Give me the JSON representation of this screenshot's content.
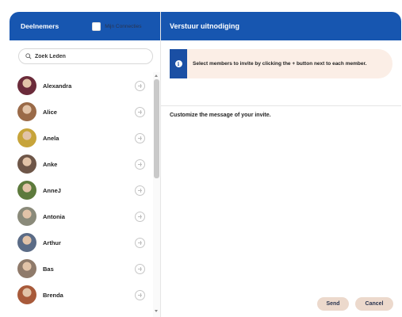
{
  "left_panel": {
    "title": "Deelnemers",
    "toggle_label": "Mijn Connecties",
    "search_placeholder": "Zoek Leden",
    "members": [
      {
        "name": "Alexandra",
        "avatar_color": "#6b2b3a"
      },
      {
        "name": "Alice",
        "avatar_color": "#9a6a48"
      },
      {
        "name": "Anela",
        "avatar_color": "#c7a43a"
      },
      {
        "name": "Anke",
        "avatar_color": "#6e5648"
      },
      {
        "name": "AnneJ",
        "avatar_color": "#5d7a3c"
      },
      {
        "name": "Antonia",
        "avatar_color": "#8a8a7a"
      },
      {
        "name": "Arthur",
        "avatar_color": "#5a6b86"
      },
      {
        "name": "Bas",
        "avatar_color": "#8f7a6a"
      },
      {
        "name": "Brenda",
        "avatar_color": "#a85a3a"
      }
    ]
  },
  "right_panel": {
    "title": "Verstuur uitnodiging",
    "info_icon": "i",
    "info_text": "Select members to invite by clicking the + button next to each member.",
    "customize_label": "Customize the message of your invite.",
    "send_label": "Send",
    "cancel_label": "Cancel"
  },
  "colors": {
    "header_blue": "#1756b0",
    "info_background": "#fbeee6",
    "button_background": "#ecd9cc"
  }
}
